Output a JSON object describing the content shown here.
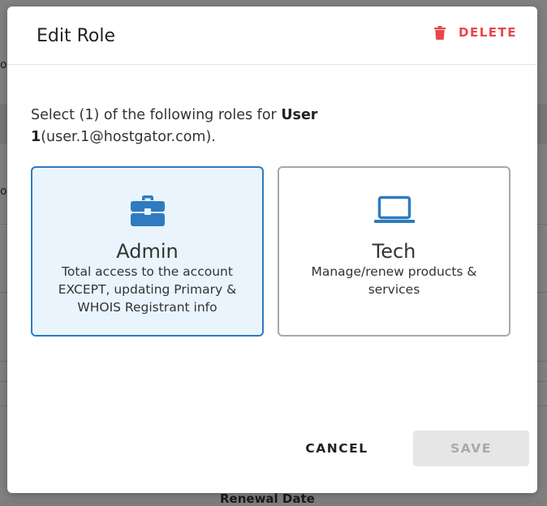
{
  "background": {
    "fragments": [
      "o",
      "o"
    ],
    "column_header": "Renewal Date"
  },
  "modal": {
    "title": "Edit Role",
    "delete_label": "DELETE",
    "prompt": {
      "prefix": "Select (1) of the following roles for ",
      "user_name": "User 1",
      "user_email": "(user.1@hostgator.com)."
    },
    "roles": [
      {
        "name": "Admin",
        "description": "Total access to the account EXCEPT, updating Primary & WHOIS Registrant info",
        "icon": "briefcase-icon",
        "selected": true
      },
      {
        "name": "Tech",
        "description": "Manage/renew products & services",
        "icon": "laptop-icon",
        "selected": false
      }
    ],
    "cancel_label": "CANCEL",
    "save_label": "SAVE"
  },
  "colors": {
    "accent": "#2f7bbf",
    "danger": "#e8474a",
    "selected_bg": "#eaf4fd",
    "disabled_bg": "#e6e6e6",
    "disabled_text": "#a9a9a9"
  }
}
